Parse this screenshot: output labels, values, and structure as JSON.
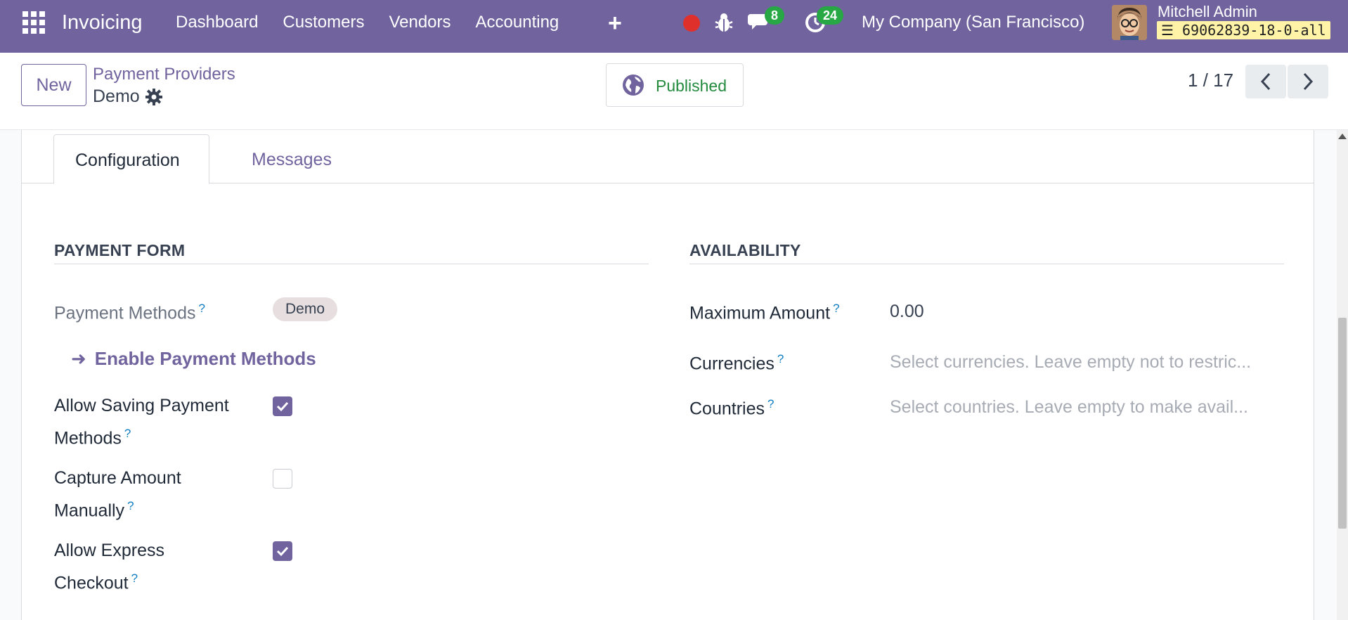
{
  "navbar": {
    "app_name": "Invoicing",
    "menu": [
      "Dashboard",
      "Customers",
      "Vendors",
      "Accounting"
    ],
    "messages_count": "8",
    "activities_count": "24",
    "company": "My Company (San Francisco)",
    "user_name": "Mitchell Admin",
    "database": "69062839-18-0-all",
    "icons": [
      "apps-grid-icon",
      "plus-icon",
      "record-icon",
      "bug-icon",
      "chat-icon",
      "clock-icon"
    ]
  },
  "control_panel": {
    "new_label": "New",
    "breadcrumb_parent": "Payment Providers",
    "record_name": "Demo",
    "published_label": "Published",
    "pager": "1 / 17"
  },
  "tabs": [
    {
      "label": "Configuration",
      "active": true
    },
    {
      "label": "Messages",
      "active": false
    }
  ],
  "payment_form": {
    "title": "PAYMENT FORM",
    "payment_methods_label": "Payment Methods",
    "payment_methods_tag": "Demo",
    "enable_link": "Enable Payment Methods",
    "allow_saving_label_1": "Allow Saving Payment",
    "allow_saving_label_2": "Methods",
    "allow_saving_checked": true,
    "capture_label_1": "Capture Amount",
    "capture_label_2": "Manually",
    "capture_checked": false,
    "express_label_1": "Allow Express",
    "express_label_2": "Checkout",
    "express_checked": true,
    "help_mark": "?"
  },
  "availability": {
    "title": "AVAILABILITY",
    "max_amount_label": "Maximum Amount",
    "max_amount_value": "0.00",
    "currencies_label": "Currencies",
    "currencies_placeholder": "Select currencies. Leave empty not to restric...",
    "countries_label": "Countries",
    "countries_placeholder": "Select countries. Leave empty to make avail..."
  },
  "colors": {
    "brand": "#71639e",
    "published_green": "#238a3e",
    "badge_green": "#28a745",
    "record_red": "#e0302b"
  }
}
